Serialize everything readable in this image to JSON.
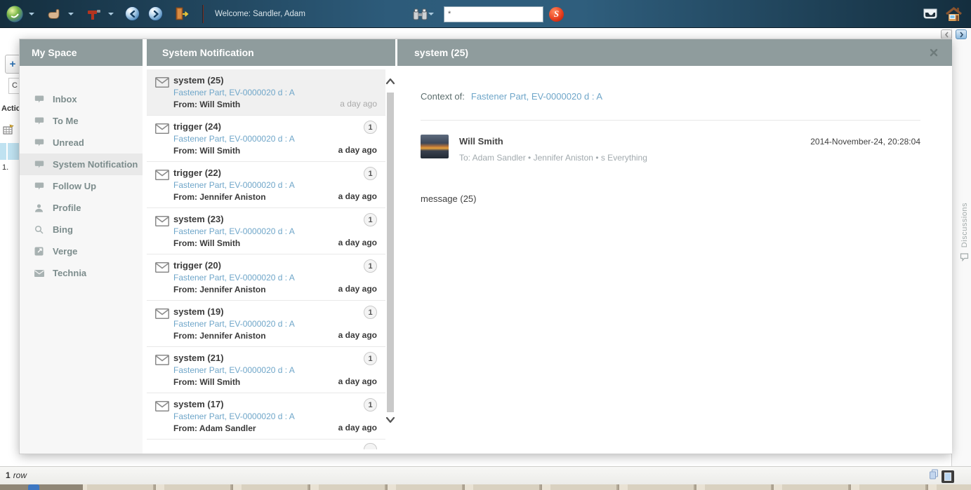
{
  "colors": {
    "topbar_teal": "#2d5b7a",
    "panel_header_gray": "#8f9c9d",
    "link_blue": "#6fa6c9",
    "selected_bg": "#f0f0f0"
  },
  "topbar": {
    "welcome_text": "Welcome: Sandler, Adam",
    "search": {
      "value": "*",
      "go_label": "S"
    },
    "icons": {
      "logo": "compass-logo",
      "actions": "hand-icon",
      "tools": "tools-icon",
      "back": "back-icon",
      "forward": "forward-icon",
      "logout": "logout-door-icon",
      "find": "binoculars-icon",
      "inbox": "tray-icon",
      "home": "home-icon"
    }
  },
  "page_behind": {
    "add_button": "+",
    "partial_field": "C",
    "actions_label": "Actio",
    "first_row_index": "1."
  },
  "overlay": {
    "sidebar": {
      "title": "My Space",
      "items": [
        {
          "label": "Inbox",
          "icon": "inbox-icon",
          "selected": false
        },
        {
          "label": "To Me",
          "icon": "inbox-icon",
          "selected": false
        },
        {
          "label": "Unread",
          "icon": "inbox-icon",
          "selected": false
        },
        {
          "label": "System Notification",
          "icon": "inbox-icon",
          "selected": true
        },
        {
          "label": "Follow Up",
          "icon": "inbox-icon",
          "selected": false
        },
        {
          "label": "Profile",
          "icon": "person-icon",
          "selected": false
        },
        {
          "label": "Bing",
          "icon": "search-icon",
          "selected": false
        },
        {
          "label": "Verge",
          "icon": "external-link-icon",
          "selected": false
        },
        {
          "label": "Technia",
          "icon": "envelope-icon",
          "selected": false
        }
      ]
    },
    "list": {
      "title": "System Notification",
      "items": [
        {
          "title": "system (25)",
          "subject": "Fastener Part, EV-0000020 d : A",
          "from": "From: Will Smith",
          "time": "a day ago",
          "badge": "",
          "unread": false,
          "selected": true
        },
        {
          "title": "trigger (24)",
          "subject": "Fastener Part, EV-0000020 d : A",
          "from": "From: Will Smith",
          "time": "a day ago",
          "badge": "1",
          "unread": true,
          "selected": false
        },
        {
          "title": "trigger (22)",
          "subject": "Fastener Part, EV-0000020 d : A",
          "from": "From: Jennifer Aniston",
          "time": "a day ago",
          "badge": "1",
          "unread": true,
          "selected": false
        },
        {
          "title": "system (23)",
          "subject": "Fastener Part, EV-0000020 d : A",
          "from": "From: Will Smith",
          "time": "a day ago",
          "badge": "1",
          "unread": true,
          "selected": false
        },
        {
          "title": "trigger (20)",
          "subject": "Fastener Part, EV-0000020 d : A",
          "from": "From: Jennifer Aniston",
          "time": "a day ago",
          "badge": "1",
          "unread": true,
          "selected": false
        },
        {
          "title": "system (19)",
          "subject": "Fastener Part, EV-0000020 d : A",
          "from": "From: Jennifer Aniston",
          "time": "a day ago",
          "badge": "1",
          "unread": true,
          "selected": false
        },
        {
          "title": "system (21)",
          "subject": "Fastener Part, EV-0000020 d : A",
          "from": "From: Will Smith",
          "time": "a day ago",
          "badge": "1",
          "unread": true,
          "selected": false
        },
        {
          "title": "system (17)",
          "subject": "Fastener Part, EV-0000020 d : A",
          "from": "From: Adam Sandler",
          "time": "a day ago",
          "badge": "1",
          "unread": true,
          "selected": false
        }
      ]
    },
    "detail": {
      "title": "system (25)",
      "context_label": "Context of:",
      "context_link": "Fastener Part, EV-0000020 d : A",
      "sender": "Will Smith",
      "recipients": "To: Adam Sandler • Jennifer Aniston • s Everything",
      "timestamp": "2014-November-24, 20:28:04",
      "body": "message (25)"
    }
  },
  "side_rail": {
    "discussions_label": "Discussions"
  },
  "statusbar": {
    "count": "1",
    "unit": "row"
  }
}
